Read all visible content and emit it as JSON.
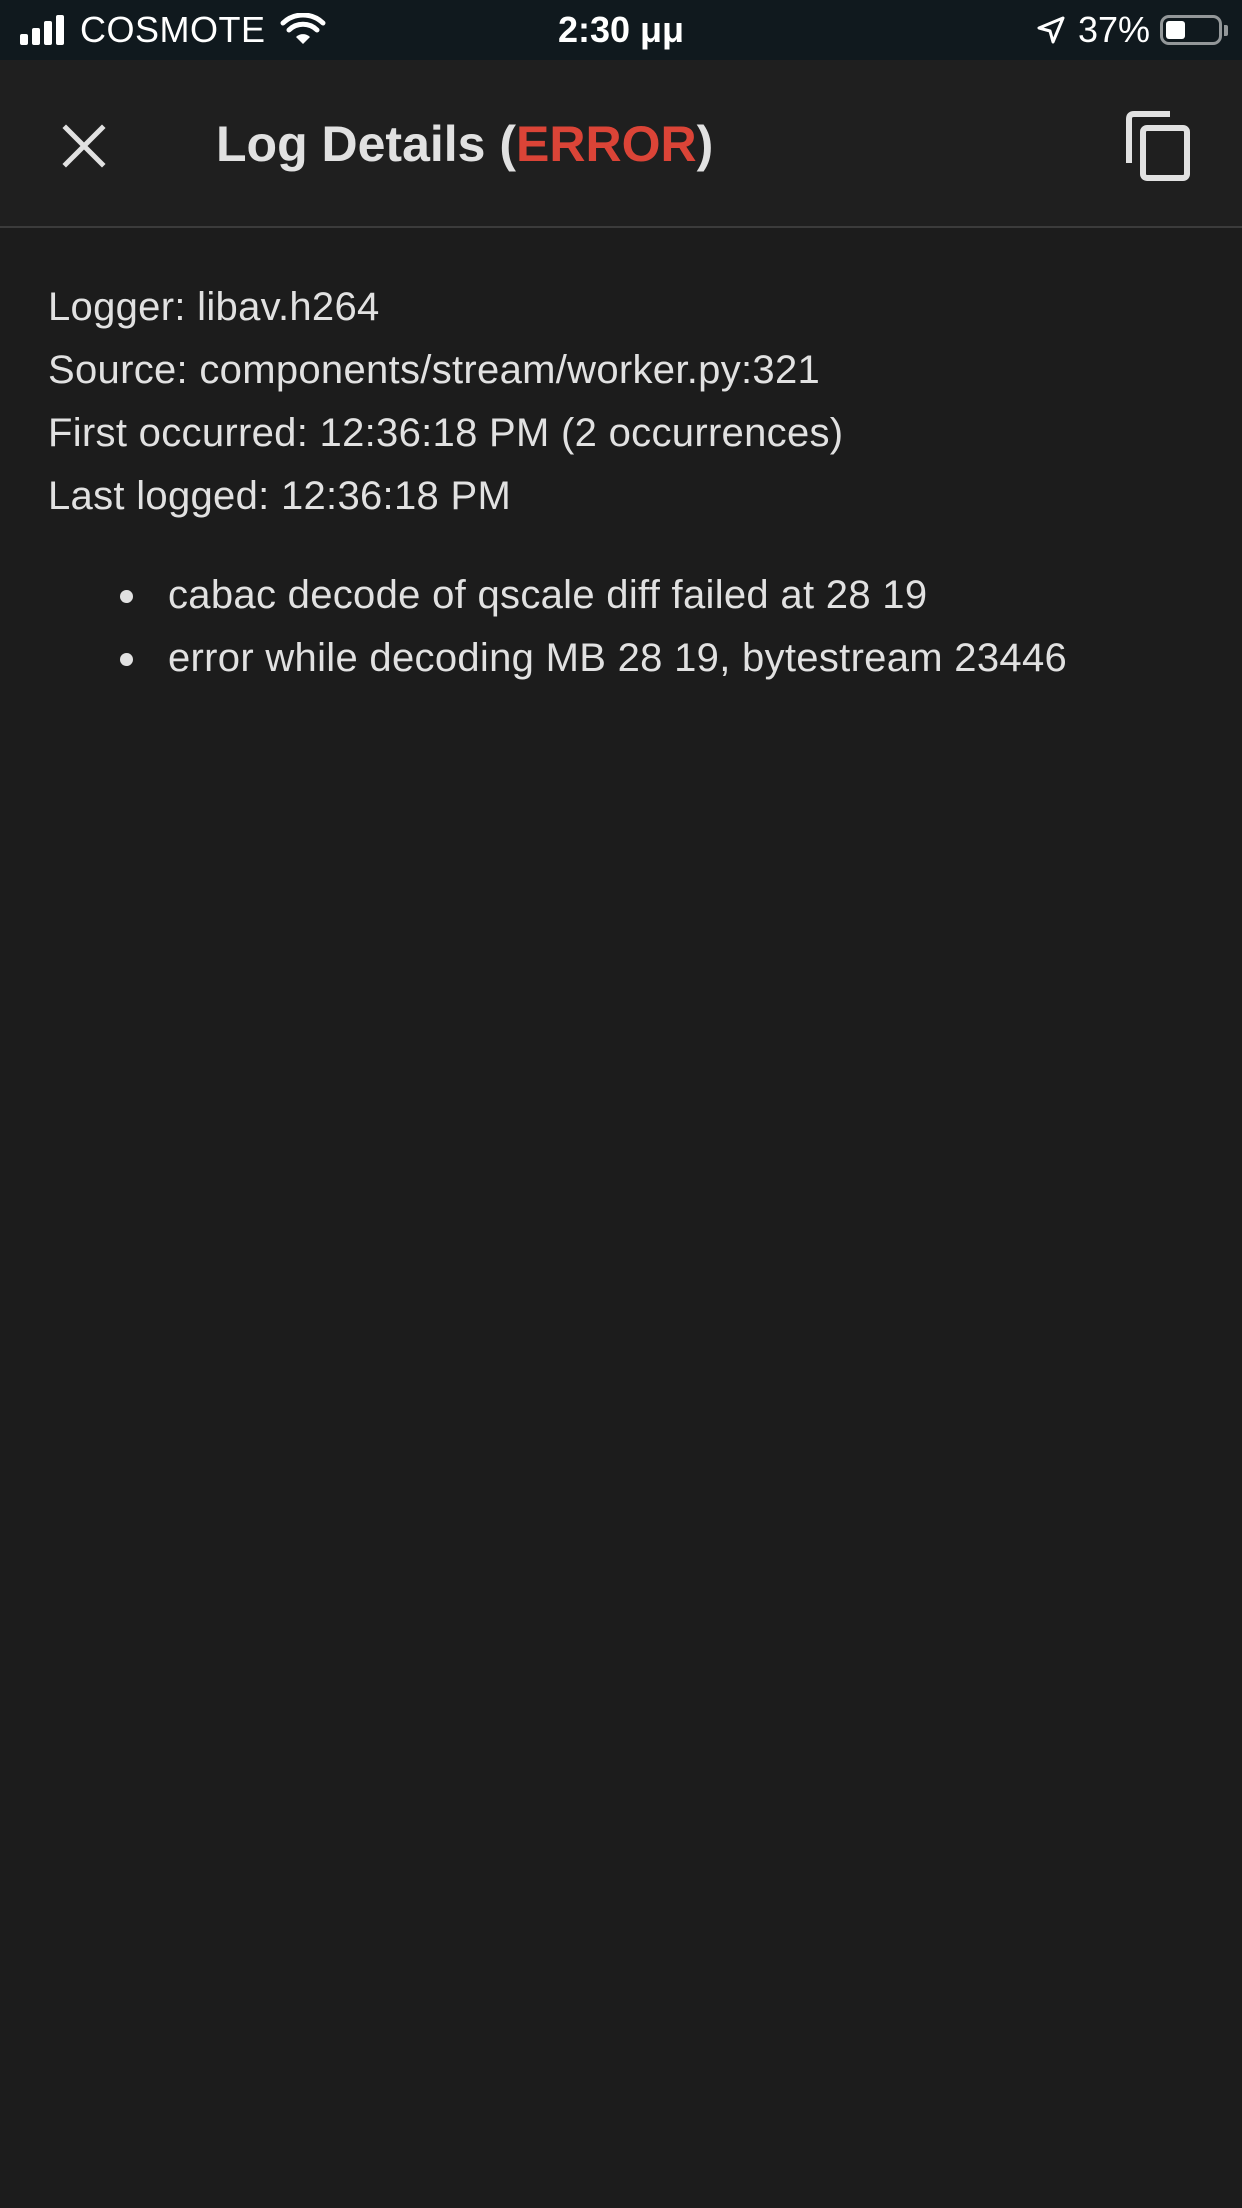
{
  "status_bar": {
    "carrier": "COSMOTE",
    "time": "2:30 μμ",
    "battery_percent": "37%",
    "battery_level": 0.37,
    "icons": [
      "signal-icon",
      "wifi-icon",
      "location-arrow-icon",
      "battery-icon"
    ]
  },
  "dialog": {
    "title_prefix": "Log Details (",
    "level": "ERROR",
    "title_suffix": ")",
    "level_color": "#db4437",
    "close_icon": "close-icon",
    "copy_icon": "copy-icon"
  },
  "details": {
    "logger": "Logger: libav.h264",
    "source": "Source: components/stream/worker.py:321",
    "first_occurred": "First occurred: 12:36:18 PM (2 occurrences)",
    "last_logged": "Last logged: 12:36:18 PM"
  },
  "messages": [
    "cabac decode of qscale diff failed at 28 19",
    "error while decoding MB 28 19, bytestream 23446"
  ],
  "colors": {
    "background": "#1c1c1c",
    "status_bar": "#10191e",
    "text": "#e1e1e1",
    "error": "#db4437"
  }
}
